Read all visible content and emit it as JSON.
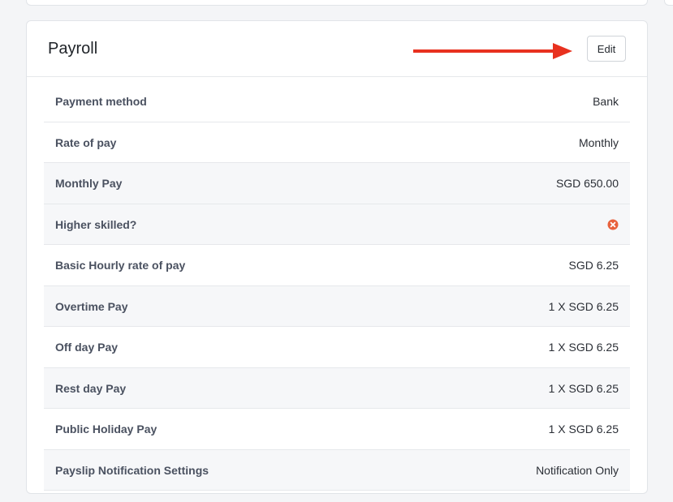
{
  "card": {
    "title": "Payroll",
    "edit_label": "Edit"
  },
  "rows": [
    {
      "label": "Payment method",
      "value": "Bank",
      "shaded": false
    },
    {
      "label": "Rate of pay",
      "value": "Monthly",
      "shaded": false
    },
    {
      "label": "Monthly Pay",
      "value": "SGD 650.00",
      "shaded": true
    },
    {
      "label": "Higher skilled?",
      "value": "",
      "icon": "x-circle-icon",
      "shaded": true
    },
    {
      "label": "Basic Hourly rate of pay",
      "value": "SGD 6.25",
      "shaded": false
    },
    {
      "label": "Overtime Pay",
      "value": "1 X SGD 6.25",
      "shaded": true
    },
    {
      "label": "Off day Pay",
      "value": "1 X SGD 6.25",
      "shaded": false
    },
    {
      "label": "Rest day Pay",
      "value": "1 X SGD 6.25",
      "shaded": true
    },
    {
      "label": "Public Holiday Pay",
      "value": "1 X SGD 6.25",
      "shaded": false
    },
    {
      "label": "Payslip Notification Settings",
      "value": "Notification Only",
      "shaded": true
    }
  ],
  "colors": {
    "arrow": "#e8311f",
    "x_icon": "#e8613c"
  }
}
